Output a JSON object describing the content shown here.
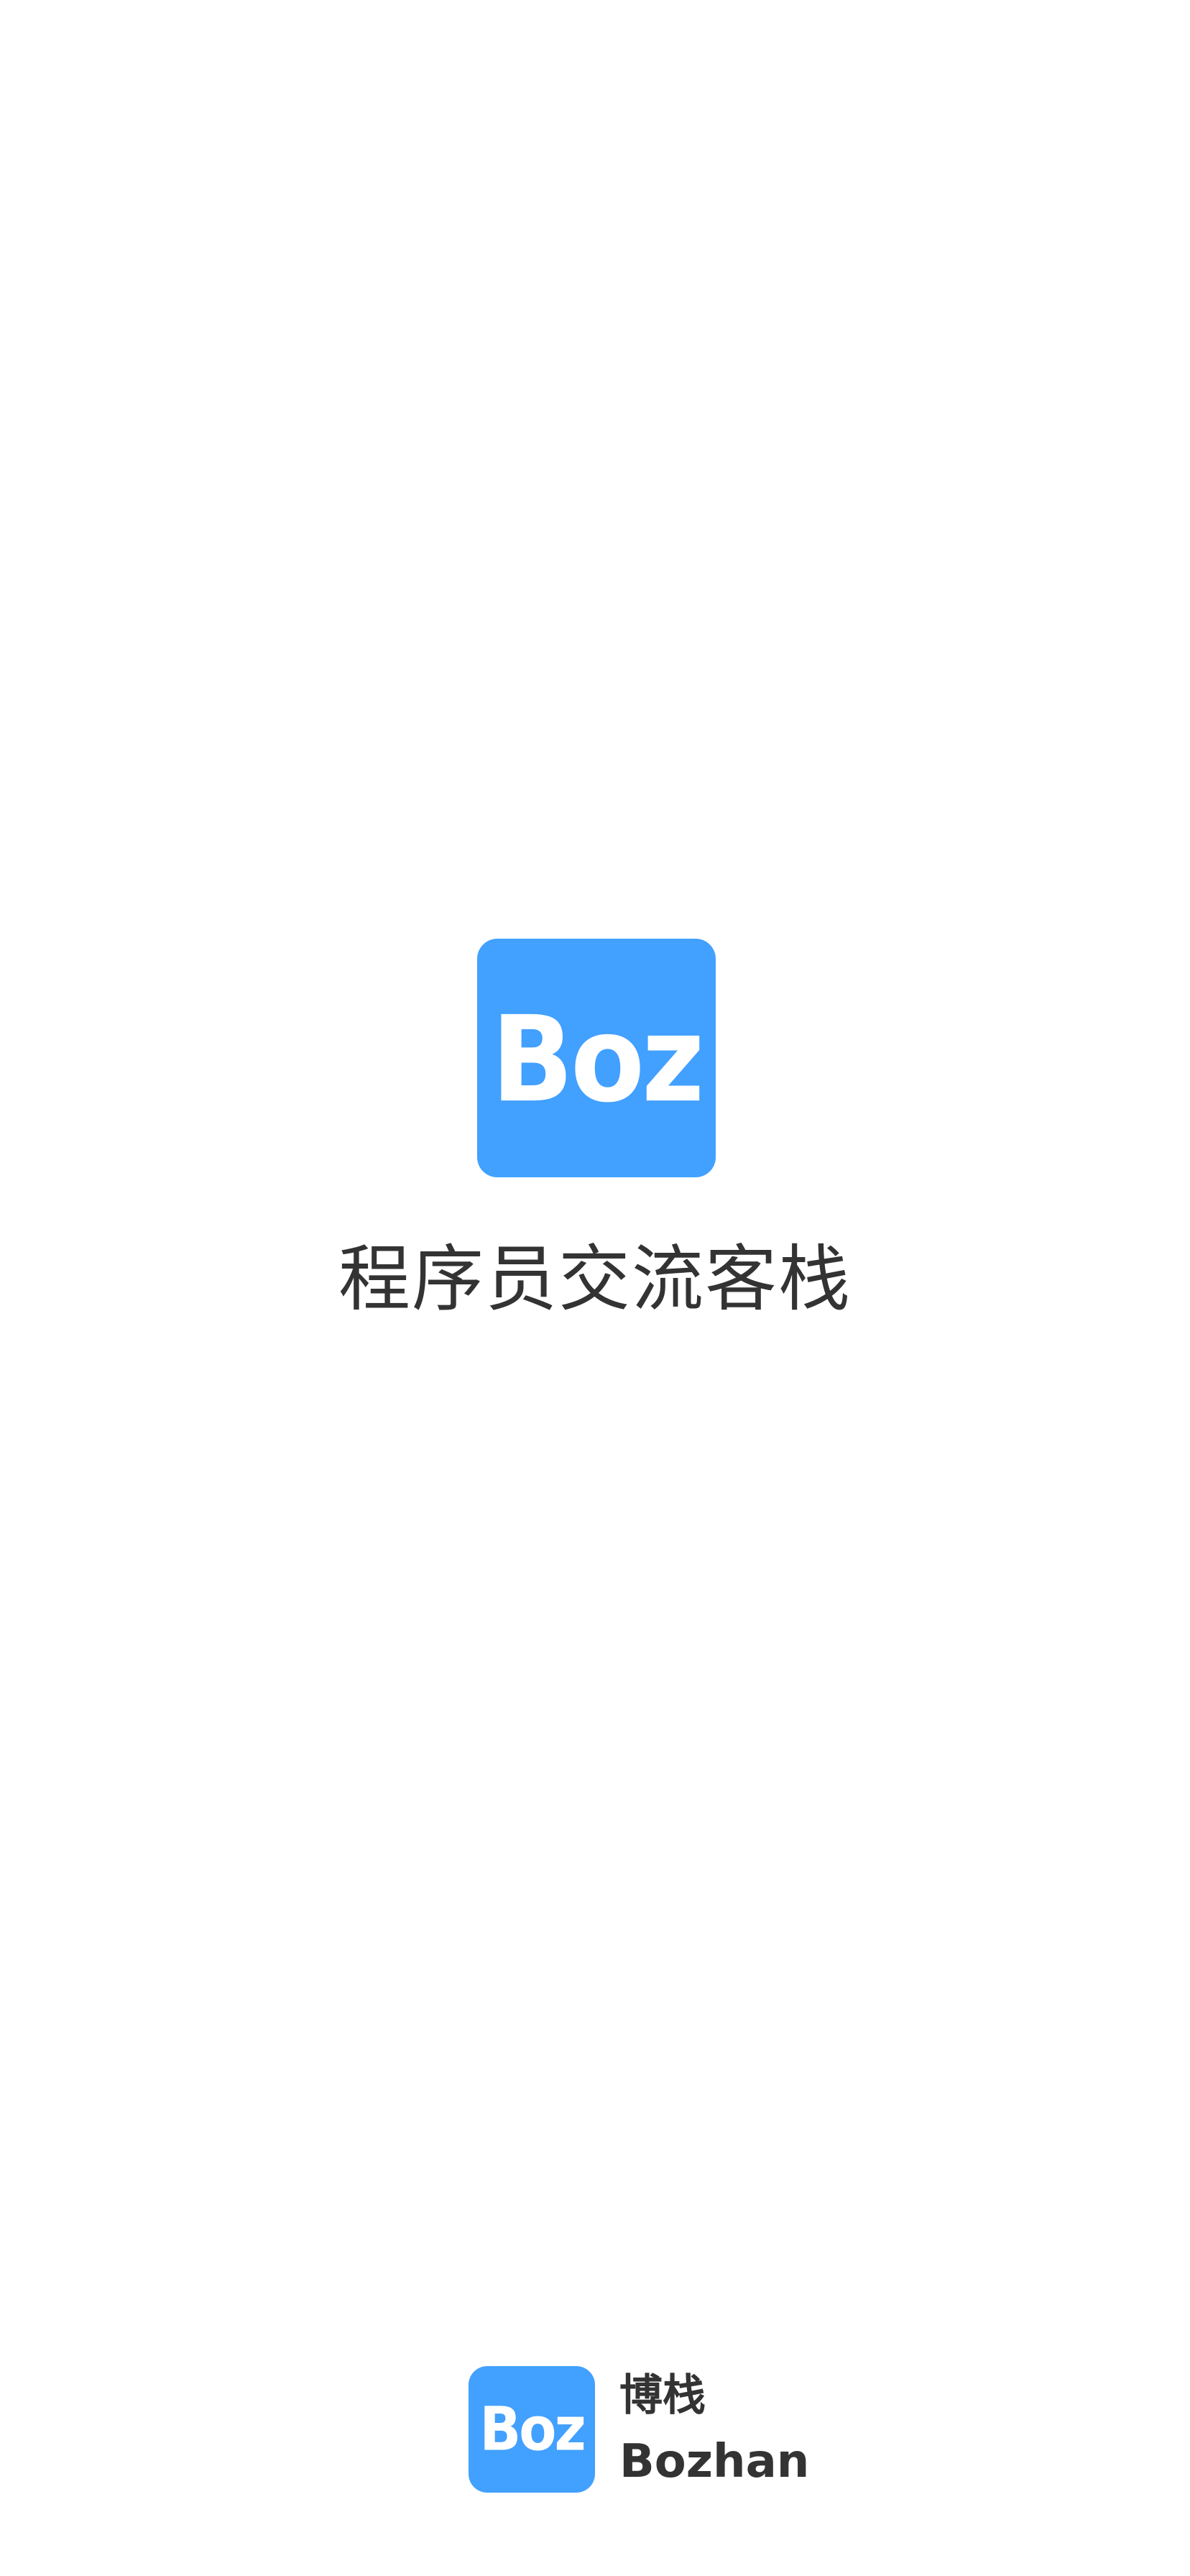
{
  "brand": {
    "accent_color": "#42a0ff",
    "logo_text": "Boz",
    "name_cn": "博栈",
    "name_en": "Bozhan"
  },
  "splash": {
    "tagline": "程序员交流客栈"
  }
}
